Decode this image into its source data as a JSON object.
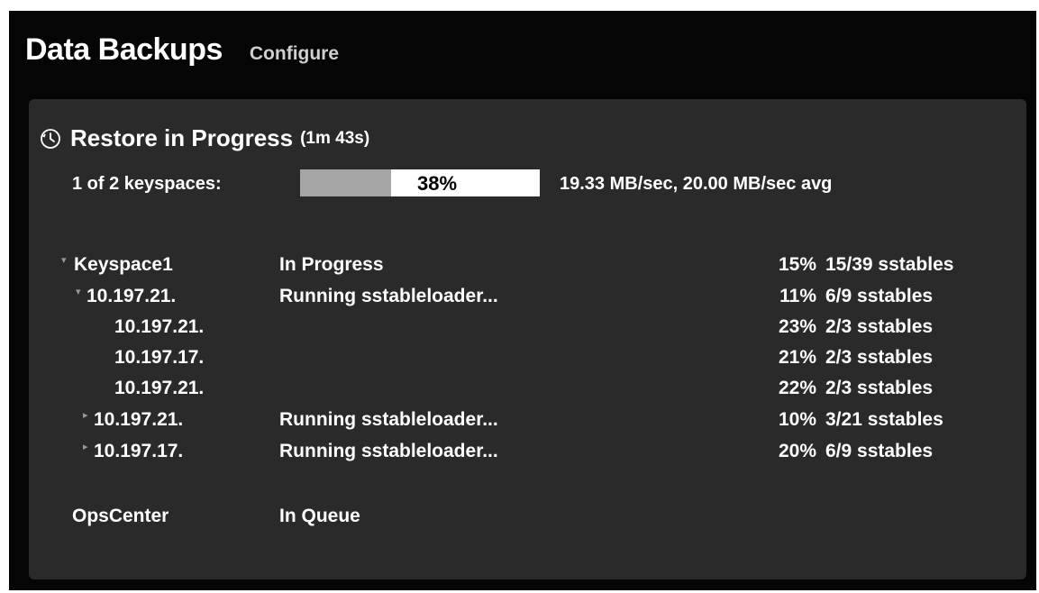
{
  "header": {
    "title": "Data Backups",
    "configure_label": "Configure"
  },
  "restore": {
    "title": "Restore in Progress",
    "elapsed": "(1m 43s)",
    "icon": "clock-icon",
    "summary_label": "1 of 2 keyspaces:",
    "progress_percent": 38,
    "progress_text": "38%",
    "rate": "19.33 MB/sec, 20.00 MB/sec avg"
  },
  "rows": [
    {
      "name": "Keyspace1",
      "status": "In Progress",
      "percent": "15%",
      "sstables": "15/39 sstables",
      "toggle": "expanded"
    },
    {
      "name": "10.197.21.",
      "status": "Running sstableloader...",
      "percent": "11%",
      "sstables": "6/9 sstables",
      "toggle": "expanded"
    },
    {
      "name": "10.197.21.",
      "status": "",
      "percent": "23%",
      "sstables": "2/3 sstables",
      "toggle": "none"
    },
    {
      "name": "10.197.17.",
      "status": "",
      "percent": "21%",
      "sstables": "2/3 sstables",
      "toggle": "none"
    },
    {
      "name": "10.197.21.",
      "status": "",
      "percent": "22%",
      "sstables": "2/3 sstables",
      "toggle": "none"
    },
    {
      "name": "10.197.21.",
      "status": "Running sstableloader...",
      "percent": "10%",
      "sstables": "3/21 sstables",
      "toggle": "collapsed"
    },
    {
      "name": "10.197.17.",
      "status": "Running sstableloader...",
      "percent": "20%",
      "sstables": "6/9 sstables",
      "toggle": "collapsed"
    }
  ],
  "queued": {
    "name": "OpsCenter",
    "status": "In Queue"
  },
  "colors": {
    "background": "#050505",
    "panel": "#2a2a2a",
    "progress_fill": "#a5a5a5",
    "progress_track": "#ffffff"
  }
}
